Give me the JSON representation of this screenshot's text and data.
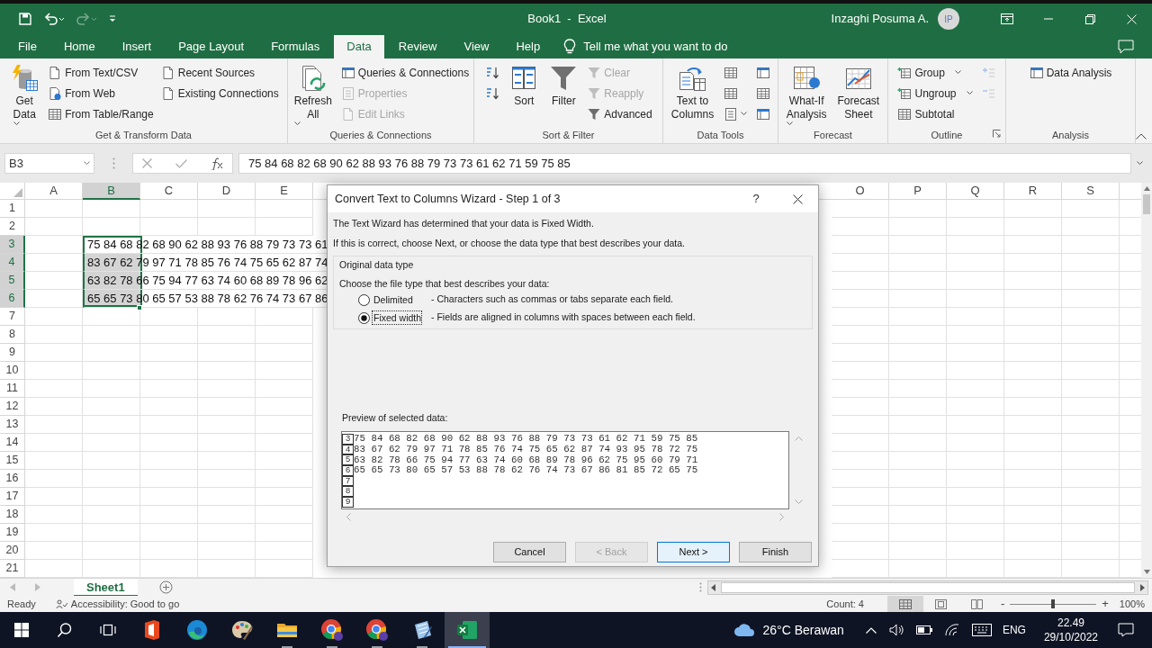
{
  "window": {
    "title": "Book1  -  Excel",
    "user": "Inzaghi Posuma A.",
    "avatar": "IP"
  },
  "quick_access": [
    {
      "kind": "save",
      "disabled": false
    },
    {
      "kind": "undo",
      "disabled": false
    },
    {
      "kind": "redo",
      "disabled": true
    },
    {
      "kind": "customize",
      "disabled": false
    }
  ],
  "tabs": [
    {
      "label": "File",
      "selected": false
    },
    {
      "label": "Home",
      "selected": false
    },
    {
      "label": "Insert",
      "selected": false
    },
    {
      "label": "Page Layout",
      "selected": false
    },
    {
      "label": "Formulas",
      "selected": false
    },
    {
      "label": "Data",
      "selected": true
    },
    {
      "label": "Review",
      "selected": false
    },
    {
      "label": "View",
      "selected": false
    },
    {
      "label": "Help",
      "selected": false
    }
  ],
  "tell_me": "Tell me what you want to do",
  "ribbon": {
    "groups": [
      {
        "label": "Get & Transform Data",
        "items": [
          {
            "kind": "large",
            "label": "Get Data",
            "dropdown": true,
            "disabled": false
          },
          {
            "kind": "column",
            "items": [
              {
                "kind": "small",
                "label": "From Text/CSV",
                "dropdown": false,
                "disabled": false
              },
              {
                "kind": "small",
                "label": "From Web",
                "dropdown": false,
                "disabled": false
              },
              {
                "kind": "small",
                "label": "From Table/Range",
                "dropdown": false,
                "disabled": false
              }
            ]
          },
          {
            "kind": "column",
            "items": [
              {
                "kind": "small",
                "label": "Recent Sources",
                "dropdown": false,
                "disabled": false
              },
              {
                "kind": "small",
                "label": "Existing Connections",
                "dropdown": false,
                "disabled": false
              }
            ]
          }
        ]
      },
      {
        "label": "Queries & Connections",
        "items": [
          {
            "kind": "large",
            "label": "Refresh All",
            "dropdown": true,
            "disabled": false
          },
          {
            "kind": "column",
            "items": [
              {
                "kind": "small",
                "label": "Queries & Connections",
                "dropdown": false,
                "disabled": false
              },
              {
                "kind": "small",
                "label": "Properties",
                "dropdown": false,
                "disabled": true
              },
              {
                "kind": "small",
                "label": "Edit Links",
                "dropdown": false,
                "disabled": true
              }
            ]
          }
        ]
      },
      {
        "label": "Sort & Filter",
        "items": [
          {
            "kind": "column",
            "items": [
              {
                "kind": "icon",
                "dropdown": false,
                "disabled": false
              },
              {
                "kind": "icon",
                "dropdown": false,
                "disabled": false
              }
            ]
          },
          {
            "kind": "large",
            "label": "Sort",
            "dropdown": false,
            "disabled": false
          },
          {
            "kind": "large",
            "label": "Filter",
            "dropdown": false,
            "disabled": false
          },
          {
            "kind": "column",
            "items": [
              {
                "kind": "small",
                "label": "Clear",
                "dropdown": false,
                "disabled": true
              },
              {
                "kind": "small",
                "label": "Reapply",
                "dropdown": false,
                "disabled": true
              },
              {
                "kind": "small",
                "label": "Advanced",
                "dropdown": false,
                "disabled": false
              }
            ]
          }
        ]
      },
      {
        "label": "Data Tools",
        "items": [
          {
            "kind": "large",
            "label": "Text to Columns",
            "dropdown": false,
            "disabled": false
          },
          {
            "kind": "column",
            "items": [
              {
                "kind": "icon",
                "dropdown": false,
                "disabled": false
              },
              {
                "kind": "icon",
                "dropdown": false,
                "disabled": false
              },
              {
                "kind": "icon",
                "dropdown": true,
                "disabled": false
              }
            ]
          },
          {
            "kind": "column",
            "items": [
              {
                "kind": "icon",
                "dropdown": false,
                "disabled": false
              },
              {
                "kind": "icon",
                "dropdown": false,
                "disabled": false
              },
              {
                "kind": "icon",
                "dropdown": false,
                "disabled": false
              }
            ]
          }
        ]
      },
      {
        "label": "Forecast",
        "items": [
          {
            "kind": "large",
            "label": "What-If Analysis",
            "dropdown": true,
            "disabled": false
          },
          {
            "kind": "large",
            "label": "Forecast Sheet",
            "dropdown": false,
            "disabled": false
          }
        ]
      },
      {
        "label": "Outline",
        "items": [
          {
            "kind": "column",
            "items": [
              {
                "kind": "small",
                "label": "Group",
                "dropdown": true,
                "disabled": false
              },
              {
                "kind": "small",
                "label": "Ungroup",
                "dropdown": true,
                "disabled": false
              },
              {
                "kind": "small",
                "label": "Subtotal",
                "dropdown": false,
                "disabled": false
              }
            ]
          },
          {
            "kind": "column",
            "items": [
              {
                "kind": "icon",
                "dropdown": false,
                "disabled": true
              },
              {
                "kind": "icon",
                "dropdown": false,
                "disabled": true
              }
            ]
          }
        ]
      },
      {
        "label": "Analysis",
        "items": [
          {
            "kind": "column",
            "items": [
              {
                "kind": "small",
                "label": "Data Analysis",
                "dropdown": false,
                "disabled": false
              }
            ]
          }
        ]
      }
    ]
  },
  "formula_bar": {
    "name_box": "B3",
    "formula": "75 84 68 82 68 90 62 88 93 76 88 79 73 73 61 62 71 59 75 85"
  },
  "sheet": {
    "left_columns": [
      {
        "label": "A",
        "selected": false
      },
      {
        "label": "B",
        "selected": true
      },
      {
        "label": "C",
        "selected": false
      },
      {
        "label": "D",
        "selected": false
      },
      {
        "label": "E",
        "selected": false
      }
    ],
    "right_columns": [
      {
        "label": "O",
        "selected": false
      },
      {
        "label": "P",
        "selected": false
      },
      {
        "label": "Q",
        "selected": false
      },
      {
        "label": "R",
        "selected": false
      },
      {
        "label": "S",
        "selected": false
      }
    ],
    "rows": [
      {
        "label": "1",
        "selected": false,
        "active": false
      },
      {
        "label": "2",
        "selected": false,
        "active": false
      },
      {
        "label": "3",
        "selected": true,
        "active": true,
        "text": "75 84 68 82 68 90 62 88 93 76 88 79 73 73 61"
      },
      {
        "label": "4",
        "selected": true,
        "active": false,
        "text": "83 67 62 79 97 71 78 85 76 74 75 65 62 87 74"
      },
      {
        "label": "5",
        "selected": true,
        "active": false,
        "text": "63 82 78 66 75 94 77 63 74 60 68 89 78 96 62"
      },
      {
        "label": "6",
        "selected": true,
        "active": false,
        "text": "65 65 73 80 65 57 53 88 78 62 76 74 73 67 86"
      },
      {
        "label": "7",
        "selected": false,
        "active": false
      },
      {
        "label": "8",
        "selected": false,
        "active": false
      },
      {
        "label": "9",
        "selected": false,
        "active": false
      },
      {
        "label": "10",
        "selected": false,
        "active": false
      },
      {
        "label": "11",
        "selected": false,
        "active": false
      },
      {
        "label": "12",
        "selected": false,
        "active": false
      },
      {
        "label": "13",
        "selected": false,
        "active": false
      },
      {
        "label": "14",
        "selected": false,
        "active": false
      },
      {
        "label": "15",
        "selected": false,
        "active": false
      },
      {
        "label": "16",
        "selected": false,
        "active": false
      },
      {
        "label": "17",
        "selected": false,
        "active": false
      },
      {
        "label": "18",
        "selected": false,
        "active": false
      },
      {
        "label": "19",
        "selected": false,
        "active": false
      },
      {
        "label": "20",
        "selected": false,
        "active": false
      },
      {
        "label": "21",
        "selected": false,
        "active": false
      }
    ]
  },
  "sheet_tabs": [
    {
      "label": "Sheet1",
      "selected": true
    }
  ],
  "status_bar": {
    "mode": "Ready",
    "accessibility": "Accessibility: Good to go",
    "count": "Count: 4",
    "zoom_out": "-",
    "zoom_in": "+",
    "zoom": "100%",
    "zoom_slider": {
      "level": 0.5
    }
  },
  "dialog": {
    "title": "Convert Text to Columns Wizard - Step 1 of 3",
    "help": "?",
    "intro": [
      "The Text Wizard has determined that your data is Fixed Width.",
      "If this is correct, choose Next, or choose the data type that best describes your data."
    ],
    "group_label": "Original data type",
    "prompt": "Choose the file type that best describes your data:",
    "options": [
      {
        "label": "Delimited",
        "description": "- Characters such as commas or tabs separate each field.",
        "selected": false,
        "focused": false
      },
      {
        "label": "Fixed width",
        "description": "- Fields are aligned in columns with spaces between each field.",
        "selected": true,
        "focused": true
      }
    ],
    "preview_label": "Preview of selected data:",
    "preview_rows": [
      {
        "number": "3",
        "text": "75 84 68 82 68 90 62 88 93 76 88 79 73 73 61 62 71 59 75 85"
      },
      {
        "number": "4",
        "text": "83 67 62 79 97 71 78 85 76 74 75 65 62 87 74 93 95 78 72 75"
      },
      {
        "number": "5",
        "text": "63 82 78 66 75 94 77 63 74 60 68 89 78 96 62 75 95 60 79 71"
      },
      {
        "number": "6",
        "text": "65 65 73 80 65 57 53 88 78 62 76 74 73 67 86 81 85 72 65 75"
      },
      {
        "number": "7"
      },
      {
        "number": "8"
      },
      {
        "number": "9"
      }
    ],
    "buttons": [
      {
        "label": "Cancel",
        "disabled": false,
        "default": false
      },
      {
        "label": "< Back",
        "disabled": true,
        "default": false
      },
      {
        "label": "Next >",
        "disabled": false,
        "default": true
      },
      {
        "label": "Finish",
        "disabled": false,
        "default": false
      }
    ]
  },
  "taskbar": {
    "apps": [
      {
        "kind": "start",
        "selected": false,
        "running": false
      },
      {
        "kind": "search",
        "selected": false,
        "running": false
      },
      {
        "kind": "task-view",
        "selected": false,
        "running": false
      },
      {
        "kind": "office",
        "selected": false,
        "running": false
      },
      {
        "kind": "edge",
        "selected": false,
        "running": false
      },
      {
        "kind": "paint",
        "selected": false,
        "running": false
      },
      {
        "kind": "explorer",
        "selected": false,
        "running": true
      },
      {
        "kind": "chrome",
        "selected": false,
        "running": true
      },
      {
        "kind": "chrome",
        "selected": false,
        "running": true
      },
      {
        "kind": "notes",
        "selected": false,
        "running": true
      },
      {
        "kind": "excel",
        "selected": true,
        "running": true
      }
    ],
    "weather": "26°C Berawan",
    "language": "ENG",
    "time": "22.49",
    "date": "29/10/2022"
  }
}
